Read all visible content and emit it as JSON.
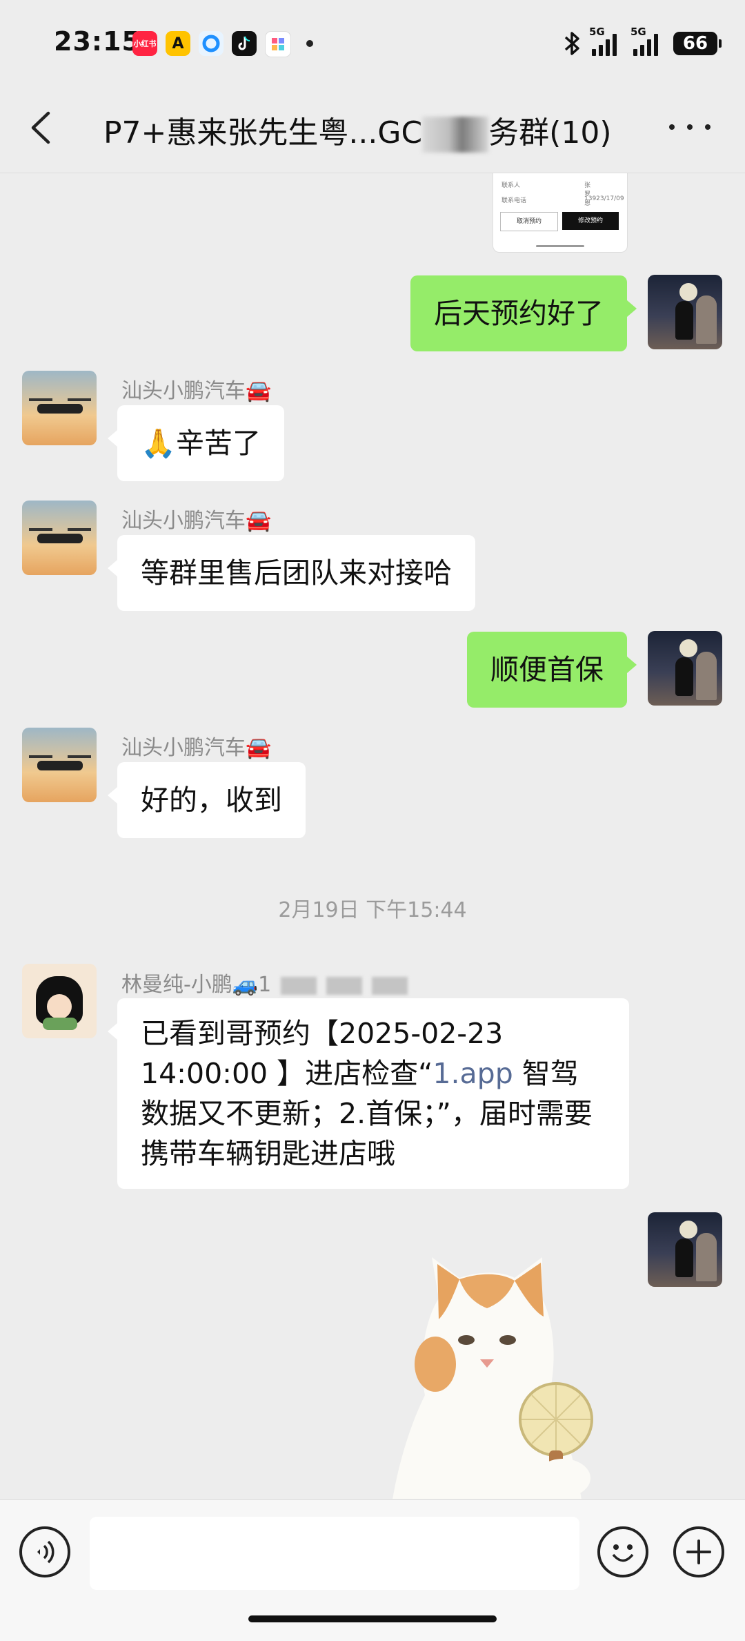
{
  "status_bar": {
    "time": "23:15",
    "app_icons": [
      "小红书",
      "A",
      "",
      "",
      ""
    ],
    "network1": "5G",
    "network2": "5G",
    "battery": "66"
  },
  "header": {
    "title_prefix": "P7+惠来张先生粤...GC",
    "title_suffix": "务群(10)"
  },
  "messages": [
    {
      "side": "out",
      "text": "后天预约好了"
    },
    {
      "side": "in",
      "sender": "汕头小鹏汽车🚘",
      "text": "🙏辛苦了"
    },
    {
      "side": "in",
      "sender": "汕头小鹏汽车🚘",
      "text": "等群里售后团队来对接哈"
    },
    {
      "side": "out",
      "text": "顺便首保"
    },
    {
      "side": "in",
      "sender": "汕头小鹏汽车🚘",
      "text": "好的，收到"
    }
  ],
  "timestamp": "2月19日 下午15:44",
  "long_message": {
    "sender": "林曼纯-小鹏🚙1",
    "part1": "已看到哥预约【2025-02-23 14:00:00 】进店检查“",
    "link": "1.app",
    "part2": " 智驾数据又不更新；2.首保；”，届时需要携带车辆钥匙进店哦"
  },
  "card_stub": {
    "row1_label": "联系人",
    "row1_value": "张罗恩",
    "row2_label": "联系电话",
    "row2_value": "13923/17/09",
    "btn_left": "取消预约",
    "btn_right": "修改预约"
  },
  "input": {
    "placeholder": ""
  },
  "colors": {
    "bubble_out": "#95ec69",
    "bubble_in": "#ffffff",
    "background": "#ededed",
    "link": "#576b95"
  }
}
